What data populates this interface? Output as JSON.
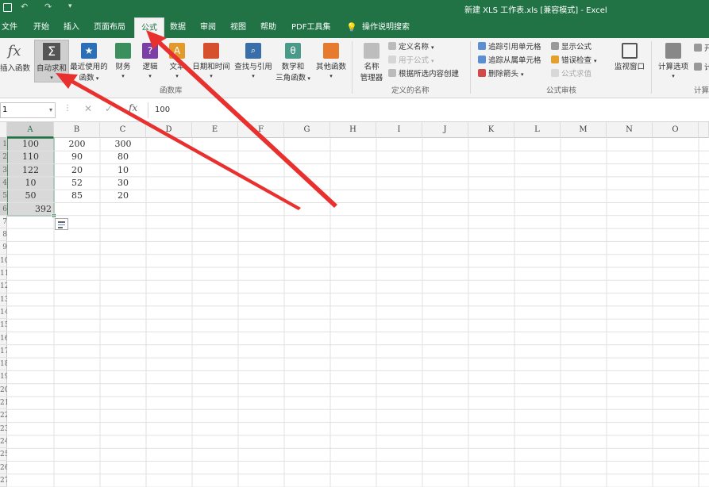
{
  "titlebar": {
    "save_icon": "save-icon",
    "undo_icon": "undo-icon",
    "redo_icon": "redo-icon",
    "title": "新建 XLS 工作表.xls  [兼容模式]  -  Excel"
  },
  "tabs": [
    "文件",
    "开始",
    "插入",
    "页面布局",
    "公式",
    "数据",
    "审阅",
    "视图",
    "帮助",
    "PDF工具集"
  ],
  "active_tab": "公式",
  "tell_me": "操作说明搜索",
  "ribbon": {
    "insert_function": "插入函数",
    "autosum_line1": "自动求和",
    "recent_line1": "最近使用的",
    "recent_line2": "函数",
    "finance": "财务",
    "logic": "逻辑",
    "text": "文本",
    "datetime": "日期和时间",
    "lookup": "查找与引用",
    "math_line1": "数学和",
    "math_line2": "三角函数",
    "other": "其他函数",
    "group_library": "函数库",
    "name_mgr_line1": "名称",
    "name_mgr_line2": "管理器",
    "define_name": "定义名称",
    "use_in_formula": "用于公式",
    "create_from_sel": "根据所选内容创建",
    "group_names": "定义的名称",
    "trace_precedents": "追踪引用单元格",
    "trace_dependents": "追踪从属单元格",
    "remove_arrows": "删除箭头",
    "show_formulas": "显示公式",
    "error_check": "错误检查",
    "evaluate": "公式求值",
    "group_audit": "公式审核",
    "watch_window": "监视窗口",
    "calc_options": "计算选项",
    "group_calc": "计算",
    "calc_now_partial": "开",
    "calc_sheet_partial": "计"
  },
  "formula_bar": {
    "name_box": "1",
    "fx": "fx",
    "content": "100"
  },
  "columns": [
    "A",
    "B",
    "C",
    "D",
    "E",
    "F",
    "G",
    "H",
    "I",
    "J",
    "K",
    "L",
    "M",
    "N",
    "O"
  ],
  "rows": [
    "1",
    "2",
    "3",
    "4",
    "5",
    "6",
    "7",
    "8",
    "9",
    "10",
    "11",
    "12",
    "13",
    "14",
    "15",
    "16",
    "17",
    "18",
    "19",
    "20",
    "21",
    "22",
    "23",
    "24",
    "25",
    "26",
    "27"
  ],
  "cells": {
    "A": [
      "100",
      "110",
      "122",
      "10",
      "50",
      "392"
    ],
    "B": [
      "200",
      "90",
      "20",
      "52",
      "85"
    ],
    "C": [
      "300",
      "80",
      "10",
      "30",
      "20"
    ]
  },
  "colors": {
    "excel_green": "#217346",
    "selection_fill": "#d9d9d9",
    "arrow_red": "#e8312f"
  }
}
